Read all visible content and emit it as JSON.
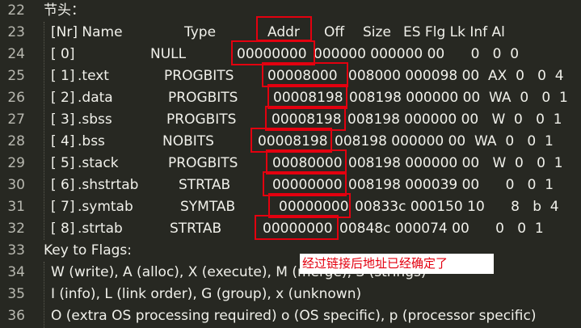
{
  "line_numbers": [
    "22",
    "23",
    "24",
    "25",
    "26",
    "27",
    "28",
    "29",
    "30",
    "31",
    "32",
    "33",
    "34",
    "35",
    "36"
  ],
  "section_title": "节头：",
  "header": {
    "nr": "[Nr] Name",
    "type": "Type",
    "addr": "Addr",
    "off": "Off",
    "size": "Size",
    "rest": "ES Flg Lk Inf Al"
  },
  "sections": [
    {
      "nr": "[ 0]",
      "name": "",
      "type": "NULL",
      "addr": "00000000",
      "rest": "000000 000000 00      0   0  0"
    },
    {
      "nr": "[ 1]",
      "name": ".text",
      "type": "PROGBITS",
      "addr": "00008000",
      "rest": "008000 000098 00  AX  0   0  4"
    },
    {
      "nr": "[ 2]",
      "name": ".data",
      "type": "PROGBITS",
      "addr": "00008198",
      "rest": "008198 000000 00  WA  0   0  1"
    },
    {
      "nr": "[ 3]",
      "name": ".sbss",
      "type": "PROGBITS",
      "addr": "00008198",
      "rest": "008198 000000 00   W  0   0  1"
    },
    {
      "nr": "[ 4]",
      "name": ".bss",
      "type": "NOBITS",
      "addr": "00008198",
      "rest": "008198 000000 00  WA  0   0  1"
    },
    {
      "nr": "[ 5]",
      "name": ".stack",
      "type": "PROGBITS",
      "addr": "00080000",
      "rest": "008198 000000 00   W  0   0  1"
    },
    {
      "nr": "[ 6]",
      "name": ".shstrtab",
      "type": "STRTAB",
      "addr": "00000000",
      "rest": "008198 000039 00      0   0  1"
    },
    {
      "nr": "[ 7]",
      "name": ".symtab",
      "type": "SYMTAB",
      "addr": "00000000",
      "rest": "00833c 000150 10      8   b  4"
    },
    {
      "nr": "[ 8]",
      "name": ".strtab",
      "type": "STRTAB",
      "addr": "00000000",
      "rest": "00848c 000074 00      0   0  1"
    }
  ],
  "key_to_flags": "Key to Flags:",
  "flag_lines": [
    "W (write), A (alloc), X (execute), M (merge), S (strings)",
    "I (info), L (link order), G (group), x (unknown)",
    "O (extra OS processing required) o (OS specific), p (processor specific)"
  ],
  "annotation": "经过链接后地址已经确定了",
  "colors": {
    "background": "#272822",
    "text": "#f0f0ea",
    "gutter": "#b8b8b0",
    "highlight": "#e3000f",
    "annotation_bg": "#ffffff"
  }
}
